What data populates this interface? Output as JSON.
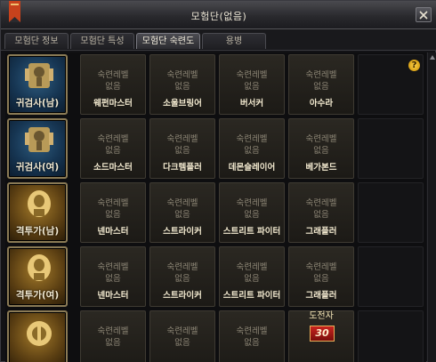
{
  "window": {
    "title": "모험단(없음)"
  },
  "tabs": [
    {
      "label": "모험단 정보",
      "active": false
    },
    {
      "label": "모험단 특성",
      "active": false
    },
    {
      "label": "모험단 숙련도",
      "active": true
    },
    {
      "label": "용병",
      "active": false
    }
  ],
  "help_icon": "?",
  "rows": [
    {
      "portrait": {
        "name": "귀검사(남)",
        "icon": "swordsman-emblem-icon"
      },
      "cells": [
        {
          "label": "숙련레벨",
          "value": "없음",
          "name": "웨펀마스터"
        },
        {
          "label": "숙련레벨",
          "value": "없음",
          "name": "소울브링어"
        },
        {
          "label": "숙련레벨",
          "value": "없음",
          "name": "버서커"
        },
        {
          "label": "숙련레벨",
          "value": "없음",
          "name": "아수라"
        }
      ]
    },
    {
      "portrait": {
        "name": "귀검사(여)",
        "icon": "swordsman-emblem-icon"
      },
      "cells": [
        {
          "label": "숙련레벨",
          "value": "없음",
          "name": "소드마스터"
        },
        {
          "label": "숙련레벨",
          "value": "없음",
          "name": "다크템플러"
        },
        {
          "label": "숙련레벨",
          "value": "없음",
          "name": "데몬슬레이어"
        },
        {
          "label": "숙련레벨",
          "value": "없음",
          "name": "베가본드"
        }
      ]
    },
    {
      "portrait": {
        "name": "격투가(남)",
        "icon": "fighter-emblem-icon"
      },
      "cells": [
        {
          "label": "숙련레벨",
          "value": "없음",
          "name": "넨마스터"
        },
        {
          "label": "숙련레벨",
          "value": "없음",
          "name": "스트라이커"
        },
        {
          "label": "숙련레벨",
          "value": "없음",
          "name": "스트리트 파이터"
        },
        {
          "label": "숙련레벨",
          "value": "없음",
          "name": "그래플러"
        }
      ]
    },
    {
      "portrait": {
        "name": "격투가(여)",
        "icon": "fighter-emblem-icon"
      },
      "cells": [
        {
          "label": "숙련레벨",
          "value": "없음",
          "name": "넨마스터"
        },
        {
          "label": "숙련레벨",
          "value": "없음",
          "name": "스트라이커"
        },
        {
          "label": "숙련레벨",
          "value": "없음",
          "name": "스트리트 파이터"
        },
        {
          "label": "숙련레벨",
          "value": "없음",
          "name": "그래플러"
        }
      ]
    },
    {
      "portrait": {
        "name": "",
        "icon": "gunner-emblem-icon"
      },
      "cells": [
        {
          "label": "숙련레벨",
          "value": "없음",
          "name": ""
        },
        {
          "label": "숙련레벨",
          "value": "없음",
          "name": ""
        },
        {
          "label": "숙련레벨",
          "value": "없음",
          "name": ""
        },
        {
          "label": "",
          "value": "",
          "name": "",
          "challenger": "도전자",
          "badge": "30"
        }
      ]
    }
  ],
  "colors": {
    "accent_gold": "#8a7a55",
    "badge_red": "#c8241f",
    "text_name": "#f3ead0"
  }
}
